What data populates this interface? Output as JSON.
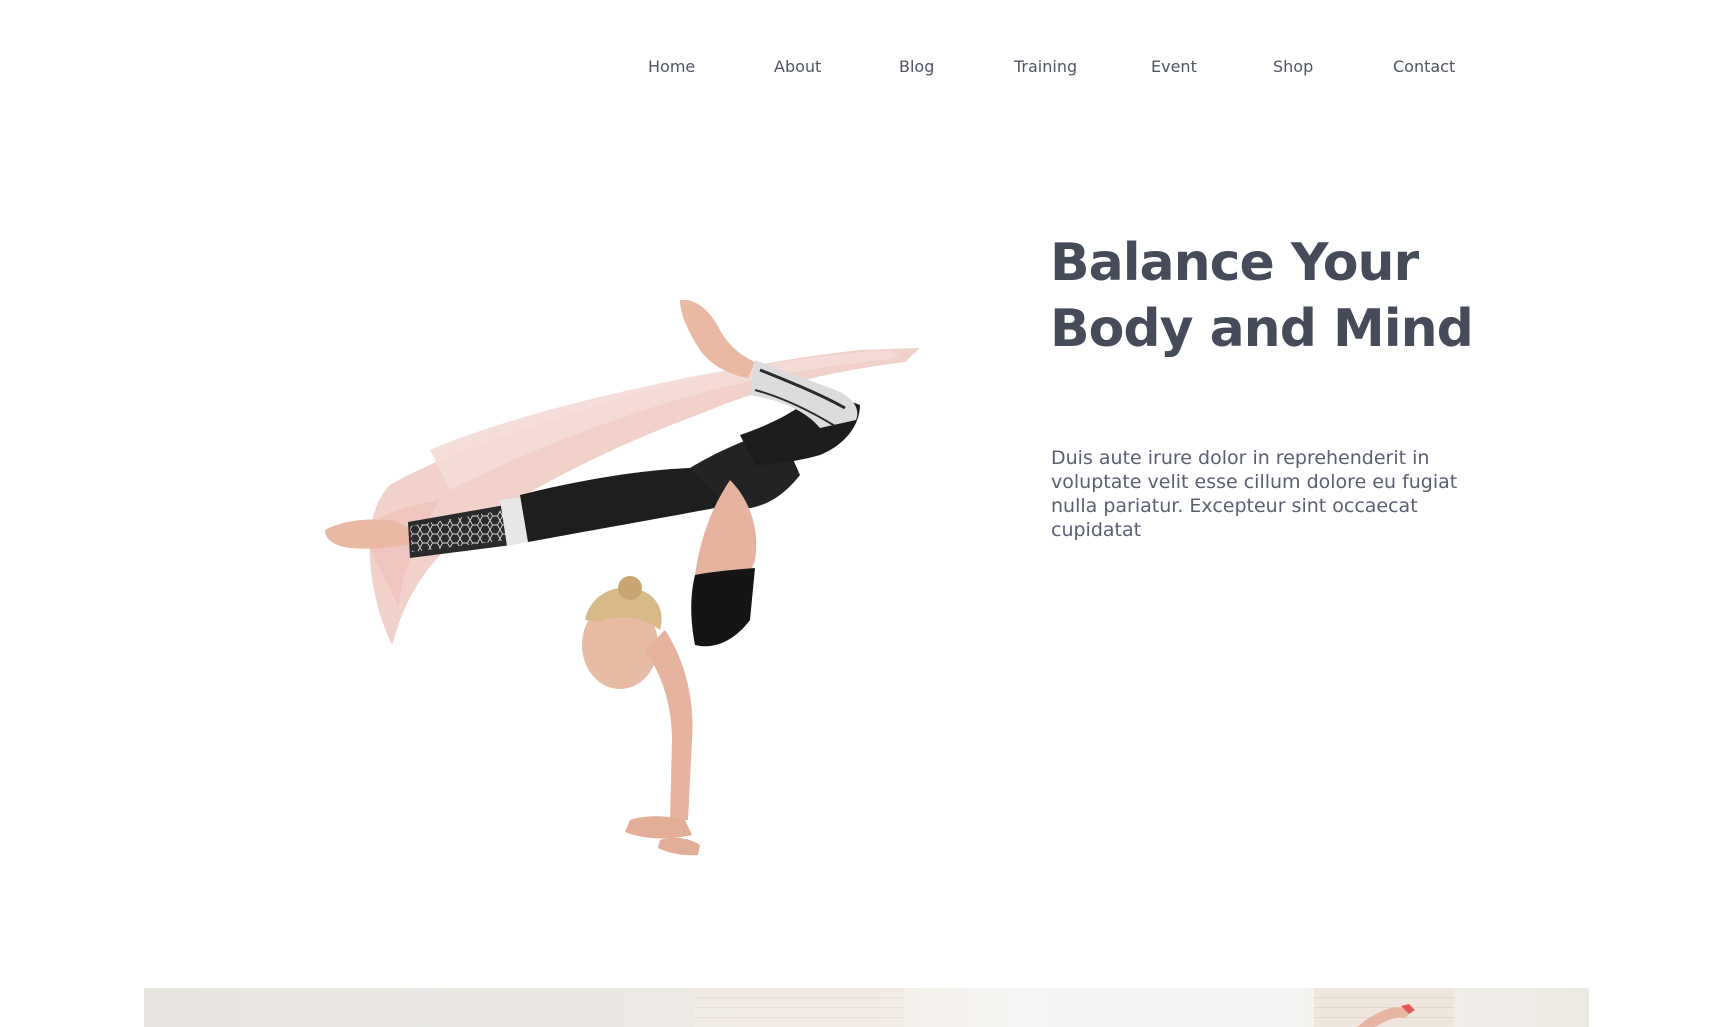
{
  "nav": {
    "items": [
      {
        "label": "Home"
      },
      {
        "label": "About"
      },
      {
        "label": "Blog"
      },
      {
        "label": "Training"
      },
      {
        "label": "Event"
      },
      {
        "label": "Shop"
      },
      {
        "label": "Contact"
      }
    ]
  },
  "hero": {
    "title_line1": "Balance Your",
    "title_line2": "Body and Mind",
    "body": "Duis aute irure dolor in reprehenderit in voluptate velit esse cillum dolore eu fugiat nulla pariatur. Excepteur sint occaecat cupidatat",
    "image_icon": "yoga-handstand-illustration"
  },
  "colors": {
    "heading": "#454b59",
    "text": "#5a6070",
    "nav": "#4f5563",
    "brush": "#f0cdc6"
  }
}
